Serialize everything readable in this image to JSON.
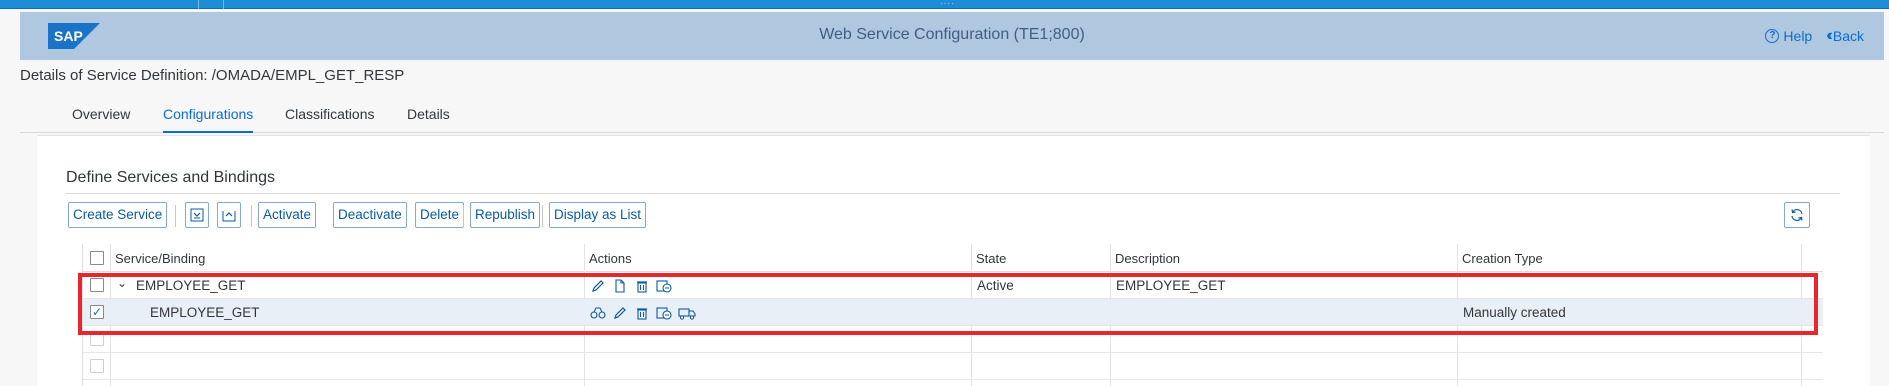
{
  "shell": {
    "logo_text": "SAP",
    "title": "Web Service Configuration (TE1;800)",
    "help_label": "Help",
    "back_label": "Back",
    "brand_color": "#0a6ed1"
  },
  "page": {
    "title": "Details of Service Definition: /OMADA/EMPL_GET_RESP"
  },
  "tabs": [
    {
      "label": "Overview",
      "selected": false
    },
    {
      "label": "Configurations",
      "selected": true
    },
    {
      "label": "Classifications",
      "selected": false
    },
    {
      "label": "Details",
      "selected": false
    }
  ],
  "section": {
    "heading": "Define Services and Bindings"
  },
  "toolbar": {
    "create_service": "Create Service",
    "expand_icon": "expand-all-icon",
    "collapse_icon": "collapse-all-icon",
    "activate": "Activate",
    "deactivate": "Deactivate",
    "delete": "Delete",
    "republish": "Republish",
    "display_as_list": "Display as List",
    "refresh_icon": "refresh-icon"
  },
  "table": {
    "columns": [
      "Service/Binding",
      "Actions",
      "State",
      "Description",
      "Creation Type"
    ],
    "rows": [
      {
        "service": "EMPLOYEE_GET",
        "expanded": true,
        "checked": false,
        "actions": [
          "edit-icon",
          "new-document-icon",
          "delete-icon",
          "documents-icon"
        ],
        "state": "Active",
        "description": "EMPLOYEE_GET",
        "creation_type": ""
      },
      {
        "service": "EMPLOYEE_GET",
        "checked": true,
        "actions": [
          "display-icon",
          "edit-icon",
          "delete-icon",
          "documents-icon",
          "transport-icon"
        ],
        "state": "",
        "description": "",
        "creation_type": "Manually created"
      }
    ]
  },
  "highlight_color": "#e8262b"
}
